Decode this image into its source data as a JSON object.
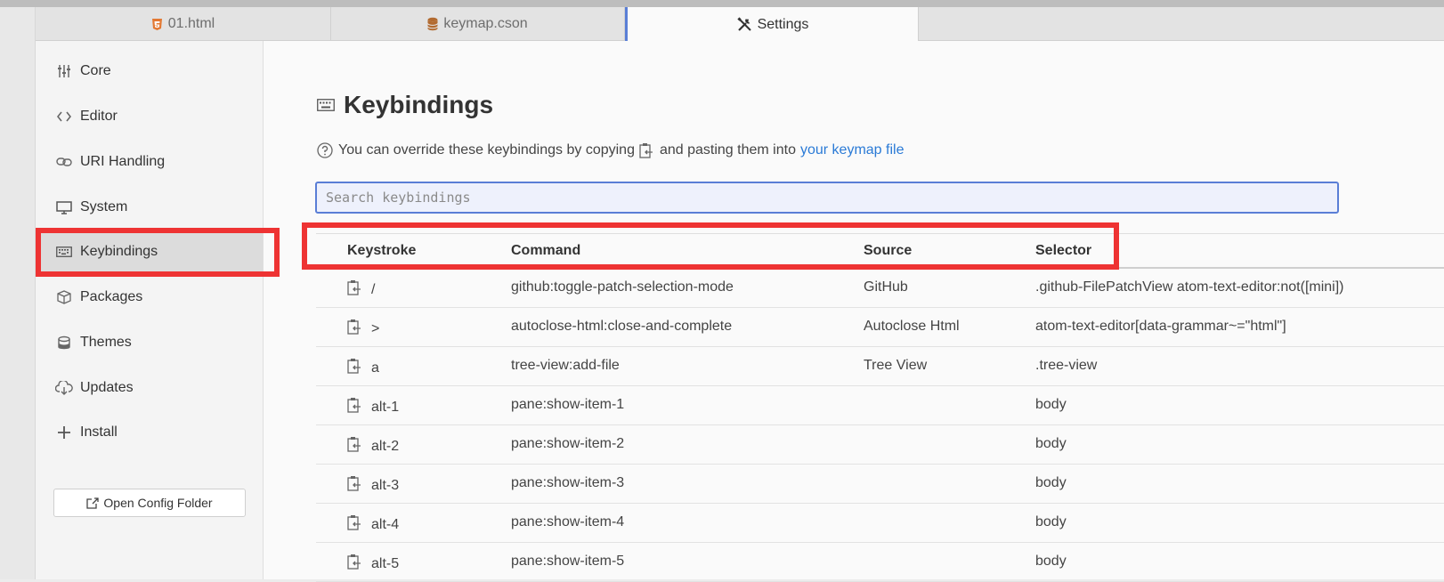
{
  "tabs": [
    {
      "label": "01.html",
      "icon": "html5-icon",
      "icon_color": "#e37933"
    },
    {
      "label": "keymap.cson",
      "icon": "database-icon",
      "icon_color": "#b26a2f"
    },
    {
      "label": "Settings",
      "icon": "tools-icon",
      "active": true
    }
  ],
  "sidebar": {
    "items": [
      {
        "label": "Core",
        "icon": "sliders-icon"
      },
      {
        "label": "Editor",
        "icon": "code-icon"
      },
      {
        "label": "URI Handling",
        "icon": "link-icon"
      },
      {
        "label": "System",
        "icon": "monitor-icon"
      },
      {
        "label": "Keybindings",
        "icon": "keyboard-icon",
        "active": true
      },
      {
        "label": "Packages",
        "icon": "package-icon"
      },
      {
        "label": "Themes",
        "icon": "paintcan-icon"
      },
      {
        "label": "Updates",
        "icon": "cloud-download-icon"
      },
      {
        "label": "Install",
        "icon": "plus-icon"
      }
    ],
    "open_config_label": "Open Config Folder"
  },
  "main": {
    "title": "Keybindings",
    "hint_before": "You can override these keybindings by copying",
    "hint_after": "and pasting them into",
    "hint_link": "your keymap file",
    "search_placeholder": "Search keybindings",
    "columns": {
      "keystroke": "Keystroke",
      "command": "Command",
      "source": "Source",
      "selector": "Selector"
    },
    "rows": [
      {
        "keystroke": "/",
        "command": "github:toggle-patch-selection-mode",
        "source": "GitHub",
        "selector": ".github-FilePatchView atom-text-editor:not([mini])"
      },
      {
        "keystroke": ">",
        "command": "autoclose-html:close-and-complete",
        "source": "Autoclose Html",
        "selector": "atom-text-editor[data-grammar~=\"html\"]"
      },
      {
        "keystroke": "a",
        "command": "tree-view:add-file",
        "source": "Tree View",
        "selector": ".tree-view"
      },
      {
        "keystroke": "alt-1",
        "command": "pane:show-item-1",
        "source": "",
        "selector": "body"
      },
      {
        "keystroke": "alt-2",
        "command": "pane:show-item-2",
        "source": "",
        "selector": "body"
      },
      {
        "keystroke": "alt-3",
        "command": "pane:show-item-3",
        "source": "",
        "selector": "body"
      },
      {
        "keystroke": "alt-4",
        "command": "pane:show-item-4",
        "source": "",
        "selector": "body"
      },
      {
        "keystroke": "alt-5",
        "command": "pane:show-item-5",
        "source": "",
        "selector": "body"
      }
    ]
  },
  "colors": {
    "accent": "#5a7ed6",
    "link": "#2a7ad6",
    "highlight": "#ee3333"
  }
}
